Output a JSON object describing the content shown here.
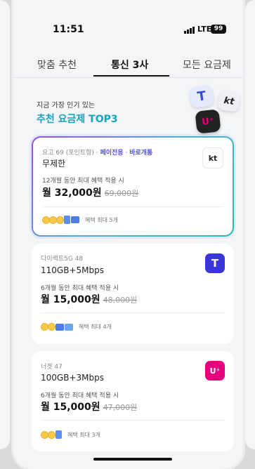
{
  "status": {
    "time": "11:51",
    "network": "LTE",
    "battery": "99"
  },
  "tabs": [
    {
      "label": "맞춤 추천",
      "active": false
    },
    {
      "label": "통신 3사",
      "active": true
    },
    {
      "label": "모든 요금제",
      "active": false
    }
  ],
  "hero": {
    "subtitle": "지금 가장 인기 있는",
    "title": "추천 요금제 TOP3",
    "logos": {
      "t": "T",
      "kt": "kt",
      "u": "U⁺"
    }
  },
  "cards": [
    {
      "meta": "요고 69 (포인트형) · ",
      "tag1": "페이전용",
      "dot": " · ",
      "tag2": "바로개통",
      "name": "무제한",
      "benefit_note": "12개월 동안 최대 혜택 적용 시",
      "price": "월 32,000원",
      "original_price": "69,000원",
      "benefit_count": "혜택 최대 5개",
      "carrier": "kt"
    },
    {
      "meta": "다이렉트5G 48",
      "name": "110GB+5Mbps",
      "benefit_note": "6개월 동안 최대 혜택 적용 시",
      "price": "월 15,000원",
      "original_price": "48,000원",
      "benefit_count": "혜택 최대 4개",
      "carrier": "T"
    },
    {
      "meta": "너겟 47",
      "name": "100GB+3Mbps",
      "benefit_note": "6개월 동안 최대 혜택 적용 시",
      "price": "월 15,000원",
      "original_price": "47,000원",
      "benefit_count": "혜택 최대 3개",
      "carrier": "U⁺"
    }
  ],
  "colors": {
    "accent_teal": "#15a3bd",
    "skt": "#3a35d6",
    "lgu": "#e6007e",
    "tag": "#5a4fe0"
  }
}
